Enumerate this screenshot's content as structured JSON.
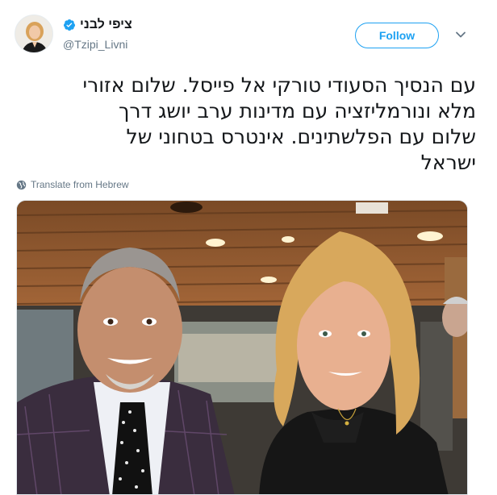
{
  "user": {
    "display_name": "ציפי לבני",
    "handle": "@Tzipi_Livni",
    "verified": true,
    "avatar_icon": "profile-photo"
  },
  "actions": {
    "follow_label": "Follow",
    "menu_icon": "chevron-down-icon"
  },
  "tweet": {
    "lines": [
      "עם הנסיך הסעודי טורקי אל פייסל. שלום אזורי",
      "מלא ונורמליזציה עם מדינות ערב  יושג דרך",
      "שלום עם הפלשתינים. אינטרס בטחוני של",
      "ישראל"
    ]
  },
  "translate": {
    "label": "Translate from Hebrew",
    "icon": "globe-icon"
  },
  "colors": {
    "accent": "#1da1f2",
    "text": "#14171a",
    "secondary": "#657786"
  }
}
